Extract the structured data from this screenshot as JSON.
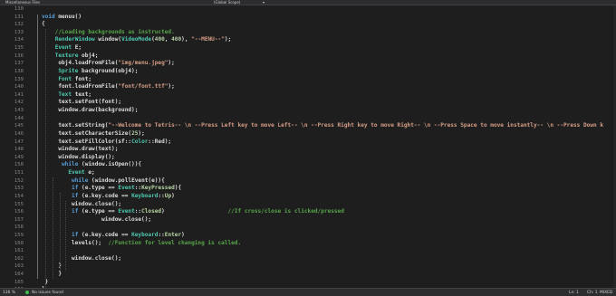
{
  "header": {
    "file_tab": "Miscellaneous Files",
    "scope": "(Global Scope)"
  },
  "editor": {
    "lines": [
      {
        "num": "130",
        "tokens": []
      },
      {
        "num": "131",
        "tokens": [
          {
            "t": "void ",
            "c": "k"
          },
          {
            "t": "menuu()",
            "c": ""
          }
        ]
      },
      {
        "num": "132",
        "tokens": [
          {
            "t": "{",
            "c": ""
          }
        ]
      },
      {
        "num": "133",
        "tokens": [
          {
            "t": "    //Loading backgrounds as instructed.",
            "c": "c"
          }
        ]
      },
      {
        "num": "134",
        "tokens": [
          {
            "t": "    ",
            "c": ""
          },
          {
            "t": "RenderWindow",
            "c": "t"
          },
          {
            "t": " window(",
            "c": ""
          },
          {
            "t": "VideoMode",
            "c": "t"
          },
          {
            "t": "(",
            "c": ""
          },
          {
            "t": "400",
            "c": "n"
          },
          {
            "t": ", ",
            "c": ""
          },
          {
            "t": "400",
            "c": "n"
          },
          {
            "t": "), ",
            "c": ""
          },
          {
            "t": "\"--MENU--\"",
            "c": "s"
          },
          {
            "t": ");",
            "c": ""
          }
        ]
      },
      {
        "num": "135",
        "tokens": [
          {
            "t": "    ",
            "c": ""
          },
          {
            "t": "Event",
            "c": "t"
          },
          {
            "t": " E;",
            "c": ""
          }
        ]
      },
      {
        "num": "136",
        "tokens": [
          {
            "t": "    ",
            "c": ""
          },
          {
            "t": "Texture",
            "c": "t"
          },
          {
            "t": " obj4;",
            "c": ""
          }
        ]
      },
      {
        "num": "137",
        "tokens": [
          {
            "t": "     obj4.loadFromFile(",
            "c": ""
          },
          {
            "t": "\"img/menu.jpeg\"",
            "c": "s"
          },
          {
            "t": ");",
            "c": ""
          }
        ]
      },
      {
        "num": "138",
        "tokens": [
          {
            "t": "     ",
            "c": ""
          },
          {
            "t": "Sprite",
            "c": "t"
          },
          {
            "t": " background(obj4);",
            "c": ""
          }
        ]
      },
      {
        "num": "139",
        "tokens": [
          {
            "t": "     ",
            "c": ""
          },
          {
            "t": "Font",
            "c": "t"
          },
          {
            "t": " font;",
            "c": ""
          }
        ]
      },
      {
        "num": "140",
        "tokens": [
          {
            "t": "     font.loadFromFile(",
            "c": ""
          },
          {
            "t": "\"font/font.ttf\"",
            "c": "s"
          },
          {
            "t": ");",
            "c": ""
          }
        ]
      },
      {
        "num": "141",
        "tokens": [
          {
            "t": "     ",
            "c": ""
          },
          {
            "t": "Text",
            "c": "t"
          },
          {
            "t": " text;",
            "c": ""
          }
        ]
      },
      {
        "num": "142",
        "tokens": [
          {
            "t": "     text.setFont(font);",
            "c": ""
          }
        ]
      },
      {
        "num": "143",
        "tokens": [
          {
            "t": "     window.draw(background);",
            "c": ""
          }
        ]
      },
      {
        "num": "144",
        "tokens": []
      },
      {
        "num": "145",
        "tokens": [
          {
            "t": "     text.setString(",
            "c": ""
          },
          {
            "t": "\"--Welcome to Tetris-- \\n --Press Left key to move Left-- \\n --Press Right key to move Right-- \\n --Press Space to move instantly-- \\n --Press Down k",
            "c": "s"
          }
        ]
      },
      {
        "num": "146",
        "tokens": [
          {
            "t": "     text.setCharacterSize(",
            "c": ""
          },
          {
            "t": "25",
            "c": "n"
          },
          {
            "t": ");",
            "c": ""
          }
        ]
      },
      {
        "num": "147",
        "tokens": [
          {
            "t": "     text.setFillColor(sf::",
            "c": ""
          },
          {
            "t": "Color",
            "c": "t"
          },
          {
            "t": "::Red);",
            "c": ""
          }
        ]
      },
      {
        "num": "148",
        "tokens": [
          {
            "t": "     window.draw(text);",
            "c": ""
          }
        ]
      },
      {
        "num": "149",
        "tokens": [
          {
            "t": "     window.display();",
            "c": ""
          }
        ]
      },
      {
        "num": "150",
        "tokens": [
          {
            "t": "      ",
            "c": ""
          },
          {
            "t": "while",
            "c": "k"
          },
          {
            "t": " (window.isOpen()){",
            "c": ""
          }
        ]
      },
      {
        "num": "151",
        "tokens": [
          {
            "t": "        ",
            "c": ""
          },
          {
            "t": "Event",
            "c": "t"
          },
          {
            "t": " e;",
            "c": ""
          }
        ]
      },
      {
        "num": "152",
        "tokens": [
          {
            "t": "         ",
            "c": ""
          },
          {
            "t": "while",
            "c": "k"
          },
          {
            "t": " (window.pollEvent(e)){",
            "c": ""
          }
        ]
      },
      {
        "num": "153",
        "tokens": [
          {
            "t": "         ",
            "c": ""
          },
          {
            "t": "if",
            "c": "k"
          },
          {
            "t": " (e.type == ",
            "c": ""
          },
          {
            "t": "Event",
            "c": "t"
          },
          {
            "t": "::",
            "c": ""
          },
          {
            "t": "KeyPressed",
            "c": "m"
          },
          {
            "t": "){",
            "c": ""
          }
        ]
      },
      {
        "num": "154",
        "tokens": [
          {
            "t": "         ",
            "c": ""
          },
          {
            "t": "if",
            "c": "k"
          },
          {
            "t": " (e.key.code == ",
            "c": ""
          },
          {
            "t": "Keyboard",
            "c": "t"
          },
          {
            "t": "::",
            "c": ""
          },
          {
            "t": "Up",
            "c": "m"
          },
          {
            "t": ")",
            "c": ""
          }
        ]
      },
      {
        "num": "155",
        "tokens": [
          {
            "t": "         window.close();",
            "c": ""
          }
        ]
      },
      {
        "num": "156",
        "tokens": [
          {
            "t": "         ",
            "c": ""
          },
          {
            "t": "if",
            "c": "k"
          },
          {
            "t": " (e.type == ",
            "c": ""
          },
          {
            "t": "Event",
            "c": "t"
          },
          {
            "t": "::",
            "c": ""
          },
          {
            "t": "Closed",
            "c": "m"
          },
          {
            "t": ")                   ",
            "c": ""
          },
          {
            "t": "//If cross/close is clicked/pressed",
            "c": "c"
          }
        ]
      },
      {
        "num": "157",
        "tokens": [
          {
            "t": "                  window.close();",
            "c": ""
          }
        ]
      },
      {
        "num": "158",
        "tokens": []
      },
      {
        "num": "159",
        "tokens": [
          {
            "t": "         ",
            "c": ""
          },
          {
            "t": "if",
            "c": "k"
          },
          {
            "t": " (e.key.code == ",
            "c": ""
          },
          {
            "t": "Keyboard",
            "c": "t"
          },
          {
            "t": "::",
            "c": ""
          },
          {
            "t": "Enter",
            "c": "m"
          },
          {
            "t": ")",
            "c": ""
          }
        ]
      },
      {
        "num": "160",
        "tokens": [
          {
            "t": "         levels();  ",
            "c": ""
          },
          {
            "t": "//Function for level changing is called.",
            "c": "c"
          }
        ]
      },
      {
        "num": "161",
        "tokens": []
      },
      {
        "num": "162",
        "tokens": [
          {
            "t": "         window.close();",
            "c": ""
          }
        ]
      },
      {
        "num": "163",
        "tokens": [
          {
            "t": "     }",
            "c": ""
          }
        ]
      },
      {
        "num": "164",
        "tokens": [
          {
            "t": "     }",
            "c": ""
          }
        ]
      },
      {
        "num": "165",
        "tokens": [
          {
            "t": " }",
            "c": ""
          }
        ]
      },
      {
        "num": "166",
        "tokens": [
          {
            "t": "}",
            "c": ""
          }
        ]
      }
    ]
  },
  "status": {
    "zoom": "136 %",
    "issues": "No issues found",
    "line": "Ln: 1",
    "char": "Ch: 1",
    "encoding": "MIXED"
  },
  "colors": {
    "background": "#1e1e1e",
    "keyword": "#569cd6",
    "type": "#4ec9b0",
    "string": "#d69d85",
    "comment": "#57a64a",
    "number": "#b5cea8"
  }
}
